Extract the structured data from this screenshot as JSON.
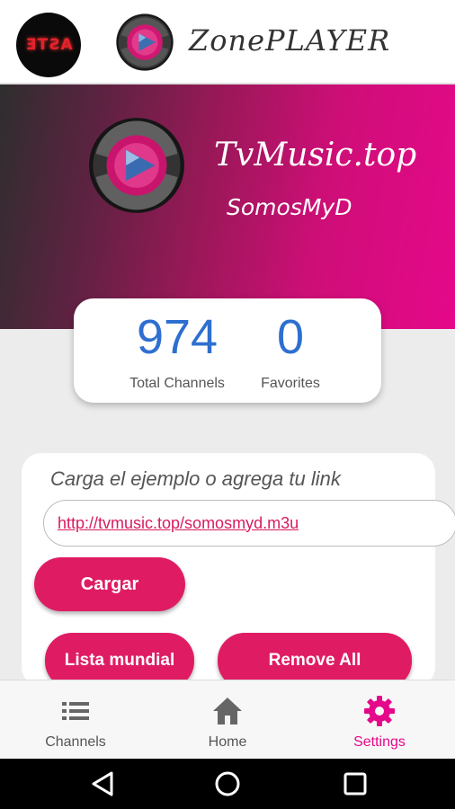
{
  "header": {
    "avatar_text": "ASTE",
    "app_title": "ZonePLAYER",
    "logo_icon": "play-disc-logo"
  },
  "hero": {
    "title": "TvMusic.top",
    "subtitle": "SomosMyD",
    "colors": {
      "start": "#2e2e2e",
      "end": "#e5088a"
    }
  },
  "stats": {
    "total_channels_value": "974",
    "total_channels_label": "Total Channels",
    "favorites_value": "0",
    "favorites_label": "Favorites",
    "number_color": "#2e6fd0"
  },
  "panel": {
    "prompt": "Carga el ejemplo o agrega tu link",
    "link_value": "http://tvmusic.top/somosmyd.m3u",
    "load_button": "Cargar",
    "world_list_button": "Lista mundial",
    "remove_all_button": "Remove All",
    "button_color": "#df1c63"
  },
  "bottom_nav": {
    "items": [
      {
        "label": "Channels",
        "icon": "list-icon",
        "active": false
      },
      {
        "label": "Home",
        "icon": "home-icon",
        "active": false
      },
      {
        "label": "Settings",
        "icon": "gear-icon",
        "active": true
      }
    ],
    "active_color": "#e5088a"
  },
  "system_nav": {
    "back_icon": "back-triangle-icon",
    "home_icon": "home-circle-icon",
    "recents_icon": "recents-square-icon"
  }
}
